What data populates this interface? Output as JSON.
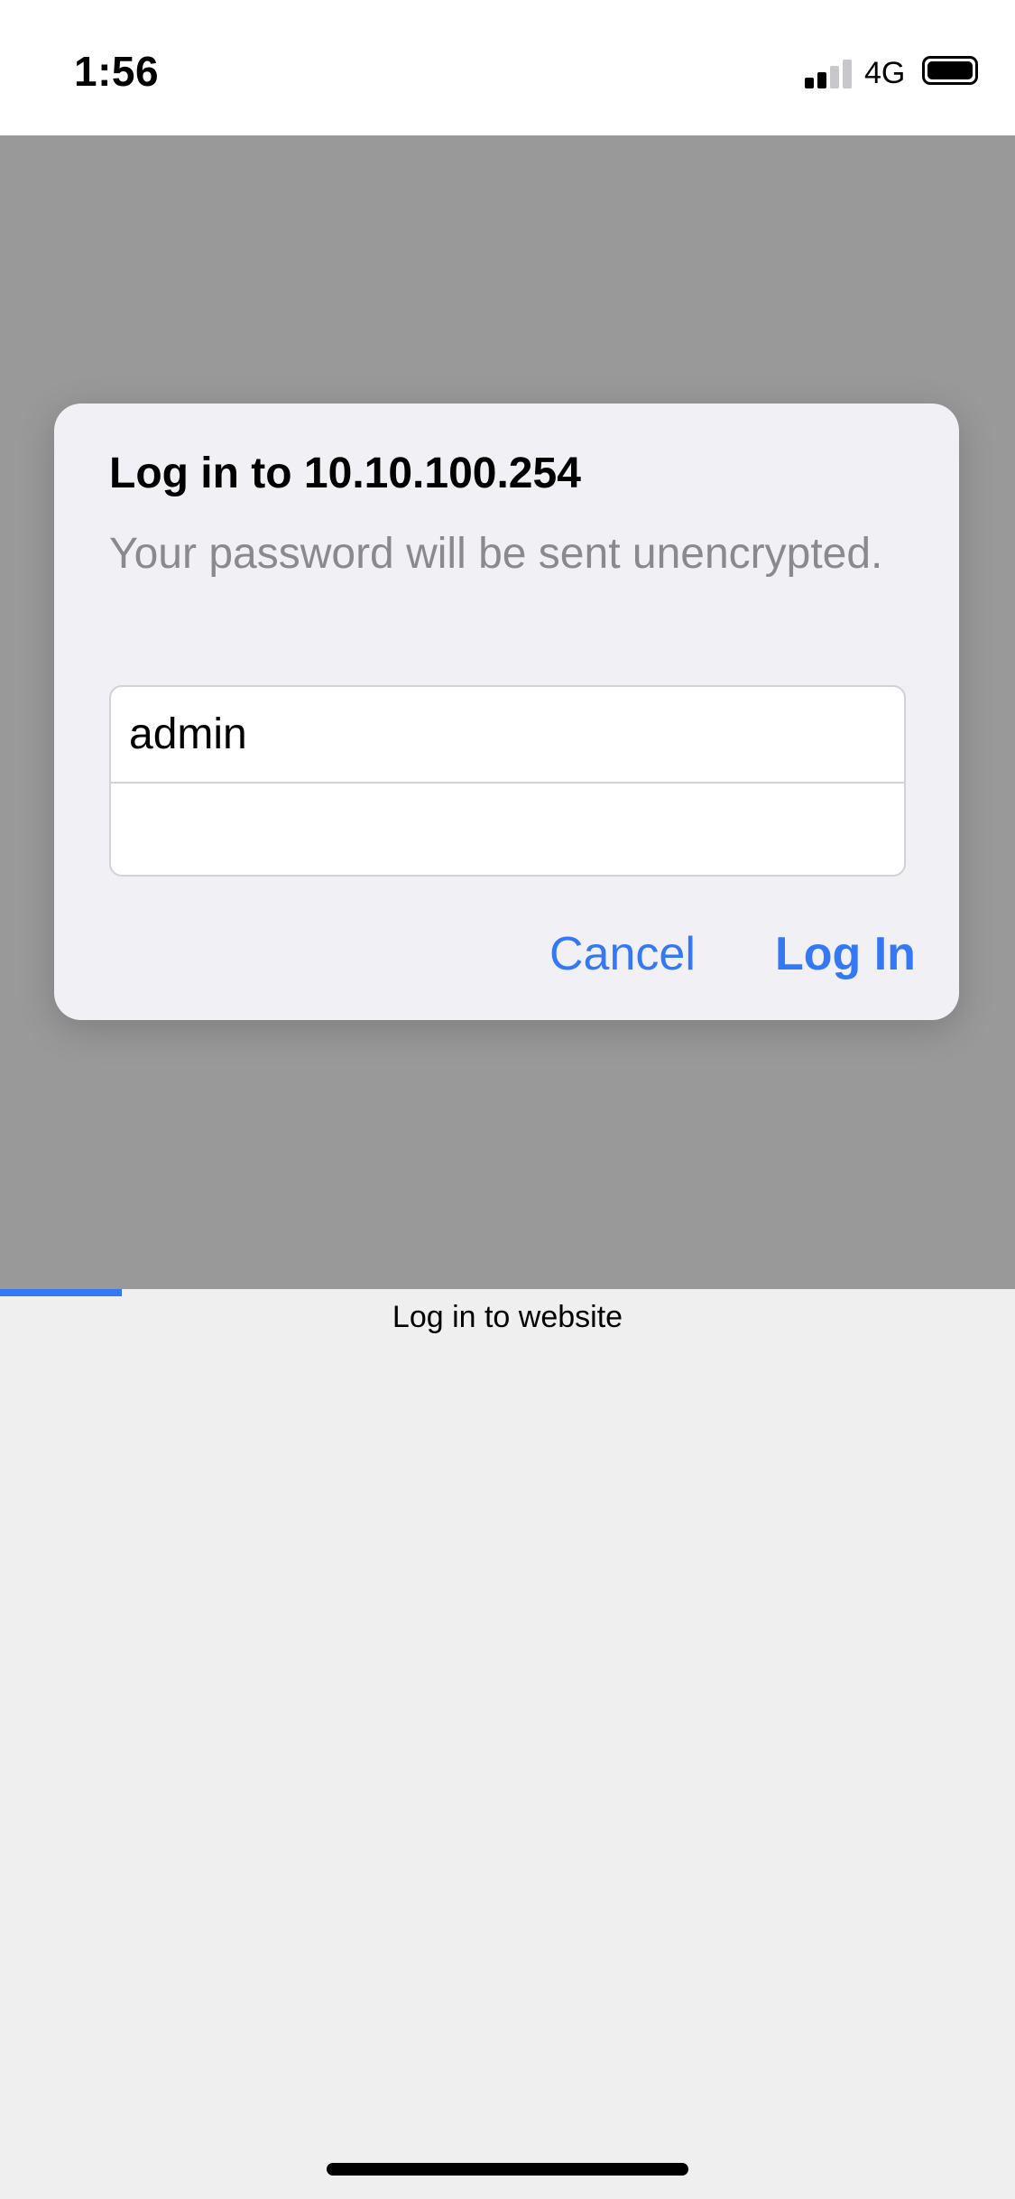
{
  "status_bar": {
    "time": "1:56",
    "network": "4G",
    "signal_bars_active": 2,
    "signal_bars_total": 4,
    "battery_level": 1.0
  },
  "dialog": {
    "title": "Log in to 10.10.100.254",
    "message": "Your password will be sent unencrypted.",
    "username_value": "admin",
    "password_value": "",
    "cancel_label": "Cancel",
    "login_label": "Log In"
  },
  "page": {
    "title": "Log in to website",
    "load_progress": 0.12
  },
  "colors": {
    "accent": "#3478f6",
    "dim_overlay": "#999999",
    "dialog_bg": "#f0f0f5",
    "secondary_text": "#8a8a8e"
  }
}
